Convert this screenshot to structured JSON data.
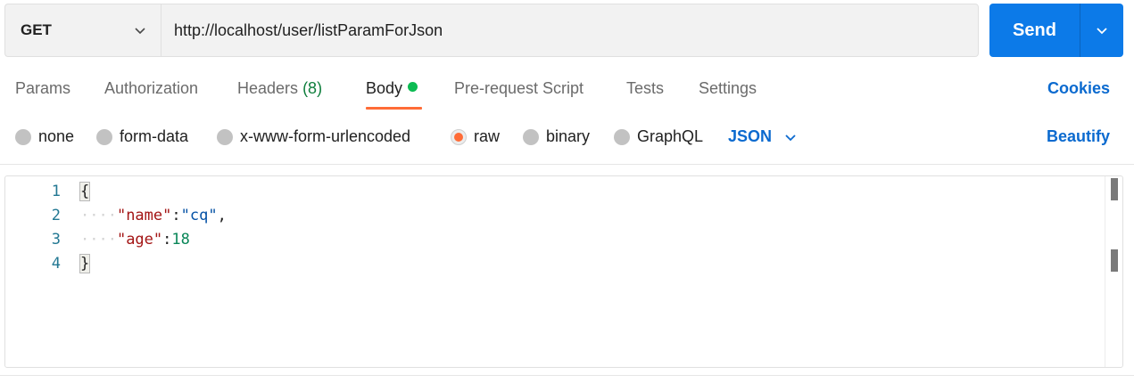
{
  "request": {
    "method": "GET",
    "url": "http://localhost/user/listParamForJson",
    "send_label": "Send"
  },
  "tabs": [
    {
      "label": "Params"
    },
    {
      "label": "Authorization"
    },
    {
      "label": "Headers",
      "count": "(8)"
    },
    {
      "label": "Body",
      "active": true
    },
    {
      "label": "Pre-request Script"
    },
    {
      "label": "Tests"
    },
    {
      "label": "Settings"
    }
  ],
  "cookies_label": "Cookies",
  "body_types": [
    {
      "label": "none"
    },
    {
      "label": "form-data"
    },
    {
      "label": "x-www-form-urlencoded"
    },
    {
      "label": "raw",
      "selected": true
    },
    {
      "label": "binary"
    },
    {
      "label": "GraphQL"
    }
  ],
  "raw_format": "JSON",
  "beautify_label": "Beautify",
  "editor": {
    "line_numbers": [
      "1",
      "2",
      "3",
      "4"
    ],
    "lines": [
      {
        "open": "{"
      },
      {
        "indent": "····",
        "key": "\"name\"",
        "colon": ":",
        "value": "\"cq\"",
        "trail": ","
      },
      {
        "indent": "····",
        "key": "\"age\"",
        "colon": ":",
        "value": "18"
      },
      {
        "close": "}"
      }
    ]
  },
  "colors": {
    "accent_blue": "#0c7ae8",
    "link_blue": "#0b6acf",
    "tab_underline": "#ff6c37",
    "status_dot": "#0cbb52"
  }
}
